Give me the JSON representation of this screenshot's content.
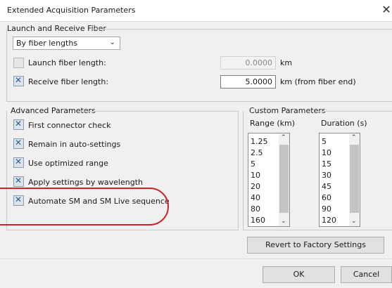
{
  "window": {
    "title": "Extended Acquisition Parameters",
    "close_glyph": "✕"
  },
  "launch_receive": {
    "group_title": "Launch and Receive Fiber",
    "mode_value": "By fiber lengths",
    "launch_label": "Launch fiber length:",
    "launch_checked": false,
    "launch_value": "0.0000",
    "launch_unit": "km",
    "receive_label": "Receive fiber length:",
    "receive_checked": true,
    "receive_value": "5.0000",
    "receive_unit": "km (from fiber end)"
  },
  "advanced": {
    "group_title": "Advanced Parameters",
    "options": [
      {
        "label": "First connector check",
        "checked": true
      },
      {
        "label": "Remain in auto-settings",
        "checked": true
      },
      {
        "label": "Use optimized range",
        "checked": true
      },
      {
        "label": "Apply settings by wavelength",
        "checked": true
      },
      {
        "label": "Automate SM and SM Live sequence",
        "checked": true
      }
    ]
  },
  "custom": {
    "group_title": "Custom Parameters",
    "range_header": "Range (km)",
    "range_values": [
      "1.25",
      "2.5",
      "5",
      "10",
      "20",
      "40",
      "80",
      "160"
    ],
    "duration_header": "Duration (s)",
    "duration_values": [
      "5",
      "10",
      "15",
      "30",
      "45",
      "60",
      "90",
      "120"
    ]
  },
  "buttons": {
    "revert": "Revert to Factory Settings",
    "ok": "OK",
    "cancel": "Cancel"
  },
  "colors": {
    "highlight": "#d0202a",
    "check_mark": "#23609e"
  }
}
